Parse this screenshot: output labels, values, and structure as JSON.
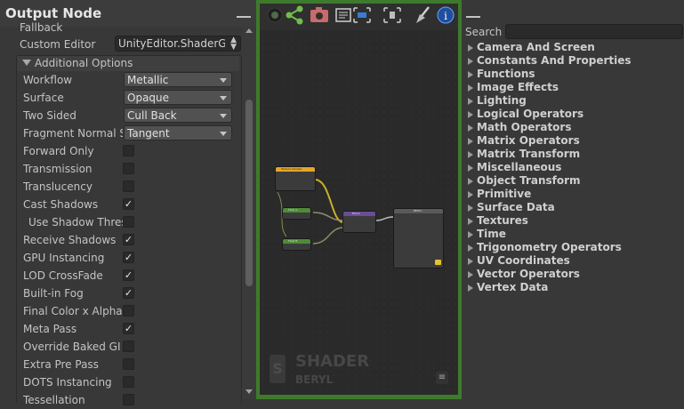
{
  "left_panel": {
    "title": "Output Node",
    "fallback_label": "Fallback",
    "custom_editor": {
      "label": "Custom Editor",
      "value": "UnityEditor.ShaderGr"
    },
    "additional_options": {
      "title": "Additional Options",
      "dropdowns": [
        {
          "label": "Workflow",
          "value": "Metallic"
        },
        {
          "label": "Surface",
          "value": "Opaque"
        },
        {
          "label": "Two Sided",
          "value": "Cull Back"
        },
        {
          "label": "Fragment Normal Sp",
          "value": "Tangent"
        }
      ],
      "toggles": [
        {
          "label": "Forward Only",
          "checked": false
        },
        {
          "label": "Transmission",
          "checked": false
        },
        {
          "label": "Translucency",
          "checked": false
        },
        {
          "label": "Cast Shadows",
          "checked": true
        },
        {
          "label": "Use Shadow Thres",
          "checked": false,
          "indent": true
        },
        {
          "label": "Receive Shadows",
          "checked": true
        },
        {
          "label": "GPU Instancing",
          "checked": true
        },
        {
          "label": "LOD CrossFade",
          "checked": true
        },
        {
          "label": "Built-in Fog",
          "checked": true
        },
        {
          "label": "Final Color x Alpha",
          "checked": false
        },
        {
          "label": "Meta Pass",
          "checked": true
        },
        {
          "label": "Override Baked GI",
          "checked": false
        },
        {
          "label": "Extra Pre Pass",
          "checked": false
        },
        {
          "label": "DOTS Instancing",
          "checked": false
        },
        {
          "label": "Tessellation",
          "checked": false
        }
      ]
    }
  },
  "canvas": {
    "watermark_line1": "SHADER",
    "watermark_line2": "BERYL",
    "toolbar_icons": [
      "live-preview-icon",
      "share-icon",
      "screenshot-icon",
      "clean-icon",
      "take-snapshot-icon",
      "show-console-icon",
      "cleanup-icon",
      "info-icon"
    ],
    "nodes": {
      "texture_sample": "Texture Sample",
      "float_a": "Float A",
      "float_b": "Float B",
      "blend": "Blend",
      "output": "BERYL"
    }
  },
  "right_panel": {
    "search_label": "Search",
    "search_placeholder": "",
    "categories": [
      "Camera And Screen",
      "Constants And Properties",
      "Functions",
      "Image Effects",
      "Lighting",
      "Logical Operators",
      "Math Operators",
      "Matrix Operators",
      "Matrix Transform",
      "Miscellaneous",
      "Object Transform",
      "Primitive",
      "Surface Data",
      "Textures",
      "Time",
      "Trigonometry Operators",
      "UV Coordinates",
      "Vector Operators",
      "Vertex Data"
    ]
  },
  "colors": {
    "accent_green": "#3e7a2c",
    "info_blue": "#3a7bd5",
    "node_orange": "#e6a52a",
    "node_green": "#4f8a38",
    "node_purple": "#6a4d94"
  }
}
